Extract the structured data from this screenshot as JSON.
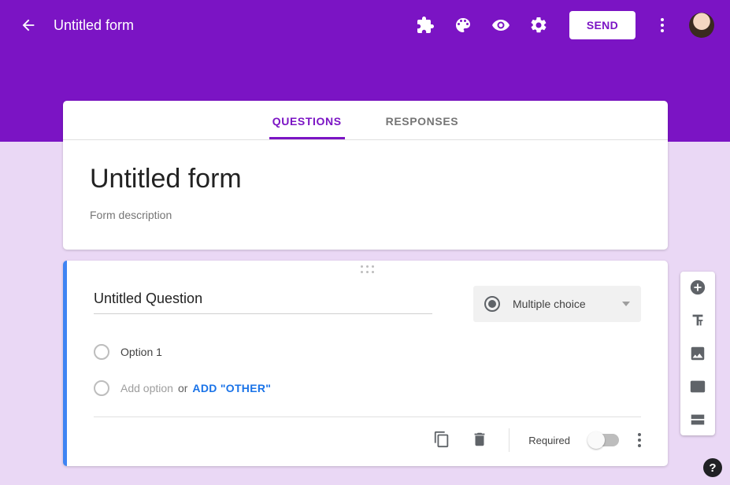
{
  "header": {
    "form_title": "Untitled form",
    "send_label": "SEND"
  },
  "tabs": {
    "questions": "QUESTIONS",
    "responses": "RESPONSES"
  },
  "title_card": {
    "form_title": "Untitled form",
    "description_placeholder": "Form description"
  },
  "question": {
    "title": "Untitled Question",
    "type_label": "Multiple choice",
    "options": [
      {
        "label": "Option 1"
      }
    ],
    "add_option_label": "Add option",
    "or_label": "or",
    "add_other_label": "ADD \"OTHER\""
  },
  "footer": {
    "required_label": "Required"
  },
  "help_label": "?"
}
